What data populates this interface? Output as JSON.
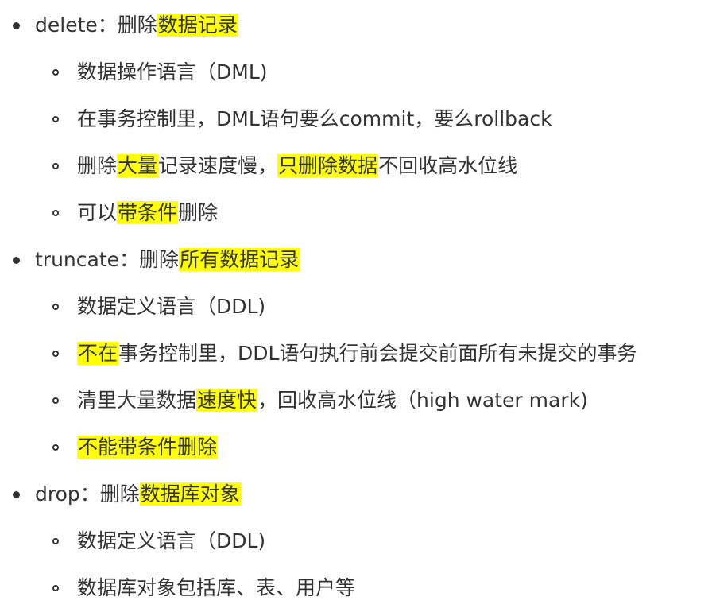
{
  "items": [
    {
      "term": "delete",
      "sep": "：",
      "plain": "删除",
      "highlight": "数据记录",
      "subitems": [
        {
          "parts": [
            {
              "text": "数据操作语言（DML)",
              "hl": false
            }
          ]
        },
        {
          "parts": [
            {
              "text": "在事务控制里，DML语句要么commit，要么rollback",
              "hl": false
            }
          ]
        },
        {
          "parts": [
            {
              "text": "删除",
              "hl": false
            },
            {
              "text": "大量",
              "hl": true
            },
            {
              "text": "记录速度慢，",
              "hl": false
            },
            {
              "text": "只删除数据",
              "hl": true
            },
            {
              "text": "不回收高水位线",
              "hl": false
            }
          ]
        },
        {
          "parts": [
            {
              "text": "可以",
              "hl": false
            },
            {
              "text": "带条件",
              "hl": true
            },
            {
              "text": "删除",
              "hl": false
            }
          ]
        }
      ]
    },
    {
      "term": "truncate",
      "sep": "：",
      "plain": "删除",
      "highlight": "所有数据记录",
      "subitems": [
        {
          "parts": [
            {
              "text": "数据定义语言（DDL)",
              "hl": false
            }
          ]
        },
        {
          "parts": [
            {
              "text": "不在",
              "hl": true
            },
            {
              "text": "事务控制里，DDL语句执行前会提交前面所有未提交的事务",
              "hl": false
            }
          ]
        },
        {
          "parts": [
            {
              "text": "清里大量数据",
              "hl": false
            },
            {
              "text": "速度快",
              "hl": true
            },
            {
              "text": "，回收高水位线（high water mark)",
              "hl": false
            }
          ]
        },
        {
          "parts": [
            {
              "text": "不能带条件删除",
              "hl": true
            }
          ]
        }
      ]
    },
    {
      "term": "drop",
      "sep": "：",
      "plain": "删除",
      "highlight": "数据库对象",
      "subitems": [
        {
          "parts": [
            {
              "text": "数据定义语言（DDL)",
              "hl": false
            }
          ]
        },
        {
          "parts": [
            {
              "text": "数据库对象包括库、表、用户等",
              "hl": false
            }
          ]
        }
      ]
    }
  ],
  "colors": {
    "text": "#333333",
    "highlight": "#ffff00",
    "background": "#ffffff"
  }
}
